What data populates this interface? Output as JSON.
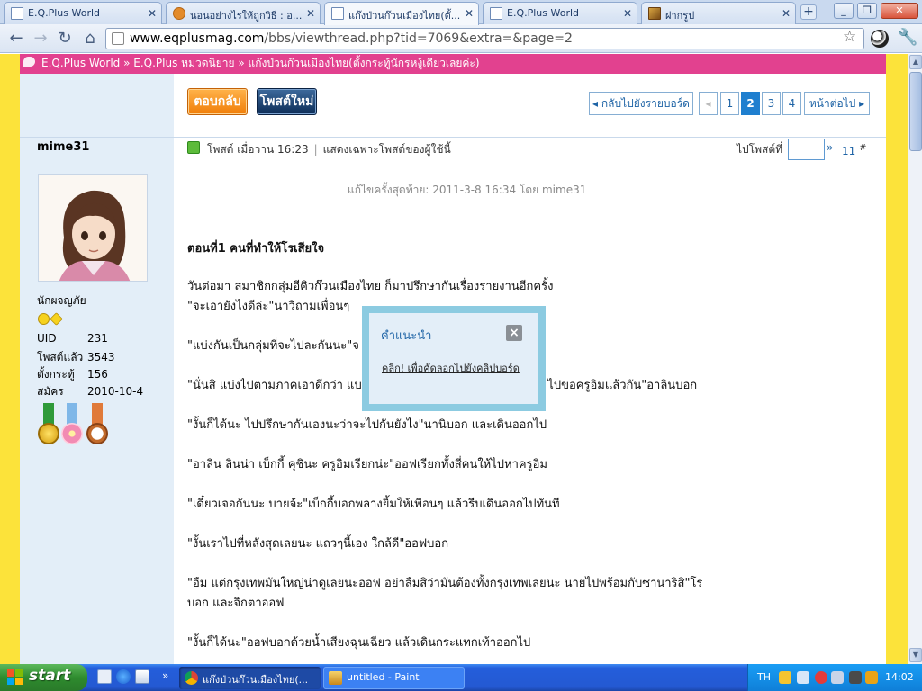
{
  "browser": {
    "tabs": [
      {
        "label": "E.Q.Plus World"
      },
      {
        "label": "นอนอย่างไรให้ถูกวิธี : อ..."
      },
      {
        "label": "แก๊งป่วนก๊วนเมืองไทย(ตั้..."
      },
      {
        "label": "E.Q.Plus World"
      },
      {
        "label": "ฝากรูป"
      }
    ],
    "address": {
      "domain": "www.eqplusmag.com",
      "path": "/bbs/viewthread.php?tid=7069&extra=&page=2"
    }
  },
  "page": {
    "breadcrumb": "E.Q.Plus World » E.Q.Plus หมวดนิยาย » แก๊งป่วนก๊วนเมืองไทย(ตั้งกระทู้นักรหงู้เดียวเลยค่ะ)",
    "buttons": {
      "reply": "ตอบกลับ",
      "new_post": "โพสต์ใหม่"
    },
    "pager": {
      "back_to_board": "◂ กลับไปยังรายบอร์ด",
      "prev": "◂",
      "pages": [
        "1",
        "2",
        "3",
        "4"
      ],
      "current": "2",
      "next": "หน้าต่อไป ▸"
    },
    "author": {
      "name": "mime31",
      "rank": "นักผจญภัย",
      "stats": [
        {
          "key": "UID",
          "value": "231"
        },
        {
          "key": "โพสต์แล้ว",
          "value": "3543"
        },
        {
          "key": "ตั้งกระทู้",
          "value": "156"
        },
        {
          "key": "สมัคร",
          "value": "2010-10-4"
        }
      ]
    },
    "post_meta": {
      "posted": "โพสต์ เมื่อวาน 16:23",
      "only_author": "แสดงเฉพาะโพสต์ของผู้ใช้นี้",
      "goto_label": "ไปโพสต์ที่",
      "goto_arrow": "»",
      "post_number": "11",
      "post_hash": "#"
    },
    "edited": "แก้ไขครั้งสุดท้าย: 2011-3-8 16:34 โดย mime31",
    "content": {
      "title": "ตอนที่1 คนที่ทำให้โรเสียใจ",
      "paragraphs": [
        "วันต่อมา สมาชิกกลุ่มอีคิวก๊วนเมืองไทย ก็มาปรึกษากันเรื่องรายงานอีกครั้ง\n\"จะเอายังไงดีล่ะ\"นาวิถามเพื่อนๆ",
        "\"แบ่งกันเป็นกลุ่มที่จะไปละกันนะ\"จ",
        "\"นั่นสิ แบ่งไปตามภาคเอาดีกว่า แบ                                                  ไปขอครูอิมแล้วกัน\"อาลินบอก",
        "\"งั้นก็ได้นะ ไปปรึกษากันเองนะว่าจะไปกันยังไง\"นานิบอก และเดินออกไป",
        "\"อาลิน ลินน่า เบ็กกี้ คุชินะ ครูอิมเรียกน่ะ\"ออฟเรียกทั้งสี่คนให้ไปหาครูอิม",
        "\"เดี๋ยวเจอกันนะ บายจ้ะ\"เบ็กกี้บอกพลางยิ้มให้เพื่อนๆ แล้วรีบเดินออกไปทันที",
        "\"งั้นเราไปที่หลังสุดเลยนะ แถวๆนี้เอง ใกล้ดี\"ออฟบอก",
        "\"อืม แต่กรุงเทพมันใหญ่น่าดูเลยนะออฟ อย่าลืมสิว่ามันต้องทั้งกรุงเทพเลยนะ นายไปพร้อมกับซานาริสิ\"โร\nบอก และจิกตาออฟ",
        "\"งั้นก็ได้นะ\"ออฟบอกด้วยน้ำเสียงฉุนเฉียว แล้วเดินกระแทกเท้าออกไป"
      ]
    },
    "popup": {
      "title": "คำแนะนำ",
      "close": "×",
      "link": "คลิก! เพื่อคัดลอกไปยังคลิปบอร์ด"
    }
  },
  "taskbar": {
    "start": "start",
    "tasks": [
      {
        "label": "แก๊งป่วนก๊วนเมืองไทย(..."
      },
      {
        "label": "untitled - Paint"
      }
    ],
    "lang": "TH",
    "clock": "14:02"
  },
  "colors": {
    "brand_pink": "#e2418f",
    "page_yellow": "#fce33a",
    "sidebar_blue": "#e3eef8",
    "link_blue": "#1f64a6",
    "reply_orange": "#f07d08",
    "newpost_navy": "#0d2d57"
  }
}
